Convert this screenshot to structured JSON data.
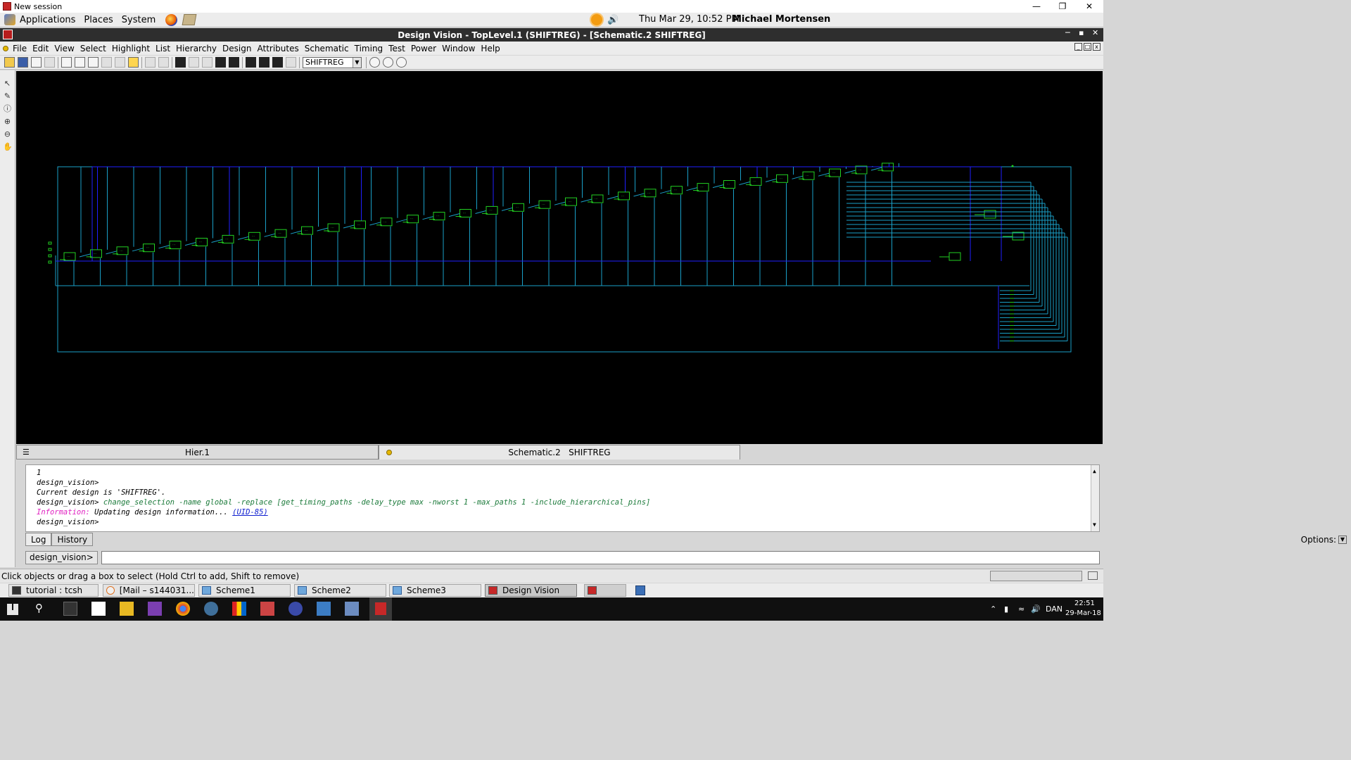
{
  "outer_window": {
    "title": "New session"
  },
  "gnome_panel": {
    "menus": [
      "Applications",
      "Places",
      "System"
    ],
    "clock": "Thu Mar 29, 10:52 PM",
    "user": "Michael Mortensen"
  },
  "app": {
    "title": "Design Vision - TopLevel.1 (SHIFTREG) - [Schematic.2   SHIFTREG]",
    "menu": [
      "File",
      "Edit",
      "View",
      "Select",
      "Highlight",
      "List",
      "Hierarchy",
      "Design",
      "Attributes",
      "Schematic",
      "Timing",
      "Test",
      "Power",
      "Window",
      "Help"
    ],
    "design_select": "SHIFTREG"
  },
  "view_tabs": [
    {
      "label": "Hier.1"
    },
    {
      "label": "Schematic.2   SHIFTREG"
    }
  ],
  "console": {
    "lines": [
      {
        "text": "1"
      },
      {
        "text": "design_vision>"
      },
      {
        "text": "Current design is 'SHIFTREG'."
      },
      {
        "prompt": "design_vision> ",
        "cmd": "change_selection -name global -replace [get_timing_paths -delay_type max -nworst 1 -max_paths 1 -include_hierarchical_pins]"
      },
      {
        "info_label": "Information:",
        "info_text": " Updating design information... ",
        "info_link": "(UID-85)"
      },
      {
        "text": "design_vision>"
      }
    ],
    "tabs": [
      "Log",
      "History"
    ],
    "options_label": "Options:",
    "prompt_label": "design_vision>",
    "input_value": ""
  },
  "status_bar": {
    "text": "Click objects or drag a box to select (Hold Ctrl to add, Shift to remove)"
  },
  "x_taskbar": {
    "items": [
      {
        "label": "tutorial : tcsh",
        "icon": "terminal-icon"
      },
      {
        "label": "[Mail – s144031...",
        "icon": "mail-icon"
      },
      {
        "label": "Scheme1",
        "icon": "folder-icon"
      },
      {
        "label": "Scheme2",
        "icon": "folder-icon"
      },
      {
        "label": "Scheme3",
        "icon": "folder-icon"
      },
      {
        "label": "Design Vision",
        "icon": "design-vision-icon"
      }
    ]
  },
  "win_taskbar": {
    "language": "DAN",
    "time": "22:51",
    "date": "29-Mar-18"
  },
  "colors": {
    "canvas_bg": "#000000",
    "wire_cyan": "#1aa0c8",
    "wire_blue": "#2020ff",
    "cell_green": "#22d022",
    "console_cmd": "#1b7a3a",
    "console_info": "#e020c0",
    "console_link": "#1020d0"
  }
}
